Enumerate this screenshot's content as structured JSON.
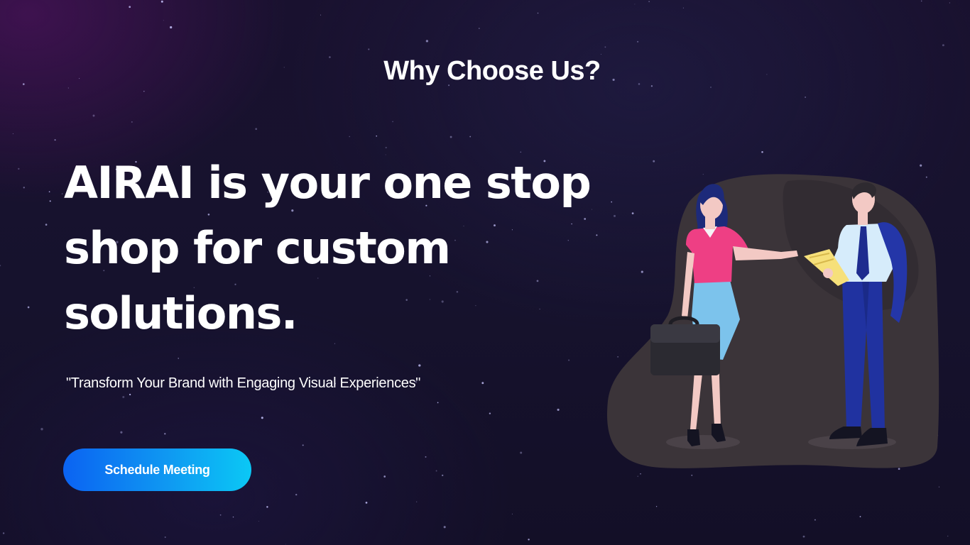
{
  "section": {
    "title": "Why Choose Us?"
  },
  "hero": {
    "headline": "AIRAI is your one stop shop for custom solutions.",
    "tagline": "\"Transform Your Brand with Engaging Visual Experiences\"",
    "cta_label": "Schedule Meeting"
  },
  "colors": {
    "background": "#17112e",
    "accent_gradient_start": "#0b63f2",
    "accent_gradient_end": "#0bc8f5",
    "blob": "#3a3238",
    "text": "#ffffff"
  },
  "illustration": {
    "icon": "business-people-illustration"
  }
}
